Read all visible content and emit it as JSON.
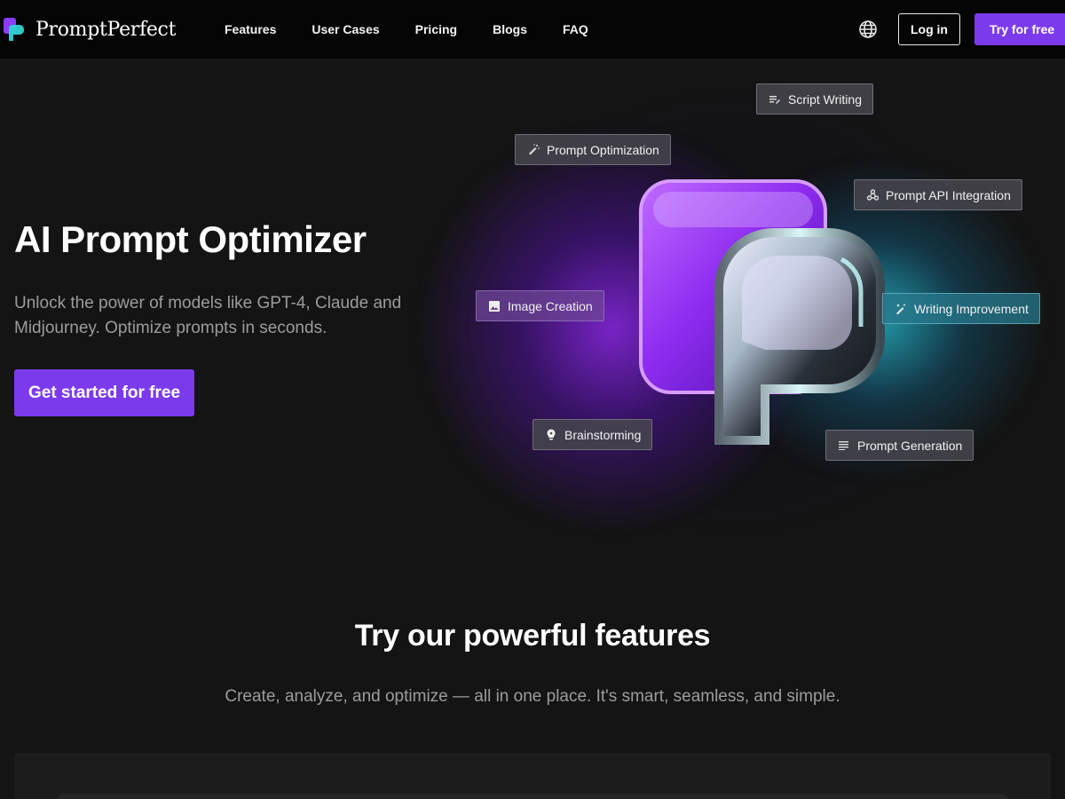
{
  "brand": {
    "name": "PromptPerfect",
    "colors": {
      "accent": "#7c3aed",
      "teal": "#2ed3d3",
      "background": "#141414",
      "nav": "#050505"
    }
  },
  "nav": {
    "links": [
      "Features",
      "User Cases",
      "Pricing",
      "Blogs",
      "FAQ"
    ],
    "language_icon": "globe-icon",
    "login_label": "Log in",
    "try_label": "Try for free"
  },
  "hero": {
    "title": "AI Prompt Optimizer",
    "subtitle": "Unlock the power of models like GPT-4, Claude and Midjourney. Optimize prompts in seconds.",
    "cta_label": "Get started for free"
  },
  "chips": [
    {
      "label": "Script Writing",
      "icon": "script-icon"
    },
    {
      "label": "Prompt Optimization",
      "icon": "magic-wand-icon"
    },
    {
      "label": "Prompt API Integration",
      "icon": "api-icon"
    },
    {
      "label": "Image Creation",
      "icon": "image-icon"
    },
    {
      "label": "Writing Improvement",
      "icon": "sparkle-edit-icon"
    },
    {
      "label": "Brainstorming",
      "icon": "lightbulb-icon"
    },
    {
      "label": "Prompt Generation",
      "icon": "text-lines-icon"
    }
  ],
  "features": {
    "title": "Try our powerful features",
    "subtitle": "Create, analyze, and optimize — all in one place. It's smart, seamless, and simple."
  }
}
